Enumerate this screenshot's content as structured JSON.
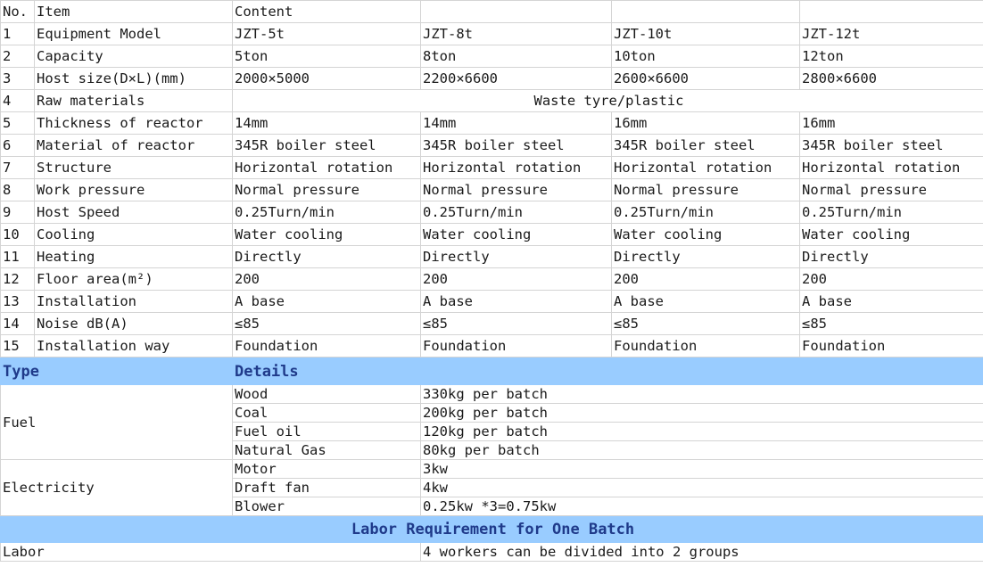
{
  "spec_table": {
    "header": {
      "no": "No.",
      "item": "Item",
      "content": "Content"
    },
    "models": [
      "JZT-5t",
      "JZT-8t",
      "JZT-10t",
      "JZT-12t"
    ],
    "rows": [
      {
        "no": "1",
        "item": "Equipment Model",
        "values": [
          "JZT-5t",
          "JZT-8t",
          "JZT-10t",
          "JZT-12t"
        ]
      },
      {
        "no": "2",
        "item": "Capacity",
        "values": [
          "5ton",
          "8ton",
          "10ton",
          "12ton"
        ]
      },
      {
        "no": "3",
        "item": "Host size(D×L)(mm)",
        "values": [
          "2000×5000",
          "2200×6600",
          "2600×6600",
          "2800×6600"
        ]
      },
      {
        "no": "4",
        "item": "Raw materials",
        "merged": "Waste tyre/plastic"
      },
      {
        "no": "5",
        "item": "Thickness of reactor",
        "values": [
          "14mm",
          "14mm",
          "16mm",
          "16mm"
        ]
      },
      {
        "no": "6",
        "item": "Material of reactor",
        "values": [
          "345R boiler steel",
          "345R boiler steel",
          "345R boiler steel",
          "345R boiler steel"
        ]
      },
      {
        "no": "7",
        "item": "Structure",
        "values": [
          "Horizontal rotation",
          "Horizontal rotation",
          "Horizontal rotation",
          "Horizontal rotation"
        ]
      },
      {
        "no": "8",
        "item": "Work pressure",
        "values": [
          "Normal pressure",
          "Normal pressure",
          "Normal pressure",
          "Normal pressure"
        ]
      },
      {
        "no": "9",
        "item": "Host Speed",
        "values": [
          "0.25Turn/min",
          "0.25Turn/min",
          "0.25Turn/min",
          "0.25Turn/min"
        ]
      },
      {
        "no": "10",
        "item": "Cooling",
        "values": [
          "Water cooling",
          "Water cooling",
          "Water cooling",
          "Water cooling"
        ]
      },
      {
        "no": "11",
        "item": "Heating",
        "values": [
          "Directly",
          "Directly",
          "Directly",
          "Directly"
        ]
      },
      {
        "no": "12",
        "item": "Floor area(m²)",
        "values": [
          "200",
          "200",
          "200",
          "200"
        ]
      },
      {
        "no": "13",
        "item": "Installation",
        "values": [
          "A base",
          "A base",
          "A base",
          "A base"
        ]
      },
      {
        "no": "14",
        "item": "Noise dB(A)",
        "values": [
          "≤85",
          "≤85",
          "≤85",
          "≤85"
        ]
      },
      {
        "no": "15",
        "item": "Installation way",
        "values": [
          "Foundation",
          "Foundation",
          "Foundation",
          "Foundation"
        ]
      }
    ]
  },
  "consumption": {
    "header": {
      "type": "Type",
      "details": "Details"
    },
    "fuel": {
      "label": "Fuel",
      "items": [
        {
          "name": "Wood",
          "value": "330kg per batch"
        },
        {
          "name": "Coal",
          "value": "200kg per batch"
        },
        {
          "name": "Fuel oil",
          "value": "120kg per batch"
        },
        {
          "name": "Natural Gas",
          "value": "80kg per batch"
        }
      ]
    },
    "electricity": {
      "label": "Electricity",
      "items": [
        {
          "name": "Motor",
          "value": "3kw"
        },
        {
          "name": "Draft fan",
          "value": "4kw"
        },
        {
          "name": "Blower",
          "value": "0.25kw *3=0.75kw"
        }
      ]
    }
  },
  "labor": {
    "header": "Labor Requirement for One Batch",
    "label": "Labor",
    "value": "4 workers can be divided into 2 groups"
  }
}
